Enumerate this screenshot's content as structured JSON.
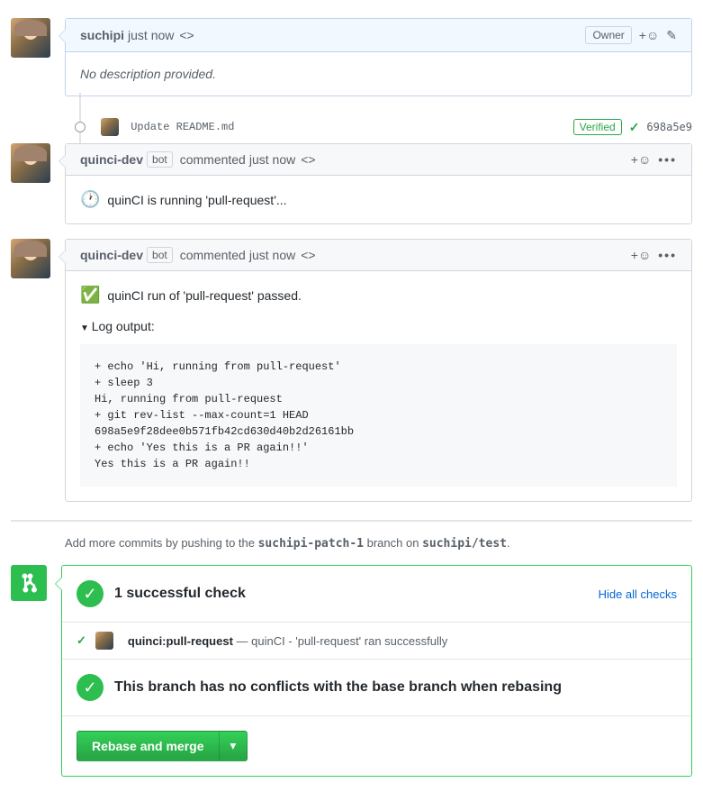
{
  "pr_author": {
    "username": "suchipi",
    "timestamp": "just now",
    "role_badge": "Owner",
    "description": "No description provided."
  },
  "commit": {
    "message": "Update README.md",
    "verified": "Verified",
    "sha": "698a5e9"
  },
  "comments": [
    {
      "author": "quinci-dev",
      "bot_label": "bot",
      "action": "commented",
      "timestamp": "just now",
      "status_emoji": "🕐",
      "status_text": "quinCI is running 'pull-request'..."
    },
    {
      "author": "quinci-dev",
      "bot_label": "bot",
      "action": "commented",
      "timestamp": "just now",
      "status_emoji": "✅",
      "status_text": "quinCI run of 'pull-request' passed.",
      "log_label": "Log output:",
      "log": "+ echo 'Hi, running from pull-request'\n+ sleep 3\nHi, running from pull-request\n+ git rev-list --max-count=1 HEAD\n698a5e9f28dee0b571fb42cd630d40b2d26161bb\n+ echo 'Yes this is a PR again!!'\nYes this is a PR again!!"
    }
  ],
  "push_hint": {
    "prefix": "Add more commits by pushing to the ",
    "branch": "suchipi-patch-1",
    "mid": " branch on ",
    "repo": "suchipi/test",
    "suffix": "."
  },
  "checks": {
    "title": "1 successful check",
    "toggle": "Hide all checks",
    "item": {
      "name": "quinci:pull-request",
      "sep": " — ",
      "desc": "quinCI - 'pull-request' ran successfully"
    }
  },
  "merge_status": "This branch has no conflicts with the base branch when rebasing",
  "merge_button": "Rebase and merge",
  "icons": {
    "reaction": "+☺",
    "kebab": "•••",
    "code": "<>",
    "pencil": "✎",
    "check": "✓",
    "caret": "▾"
  }
}
